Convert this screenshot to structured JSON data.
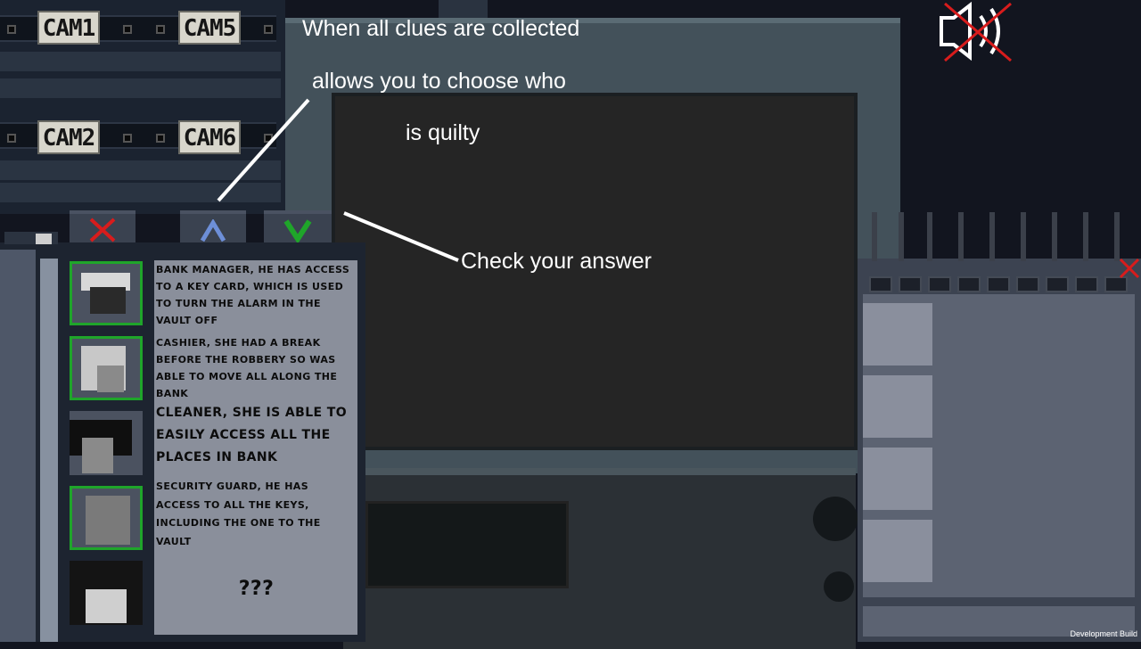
{
  "cameras": [
    {
      "label": "CAM1"
    },
    {
      "label": "CAM5"
    },
    {
      "label": "CAM2"
    },
    {
      "label": "CAM6"
    }
  ],
  "tutorial": {
    "line1": "When all clues are collected",
    "line2": "allows you to choose who",
    "line3": "is quilty",
    "check": "Check your answer"
  },
  "suspects": [
    {
      "description": "Bank manager, he has access to a key card, which is used to turn the alarm in the vault off",
      "selected": true
    },
    {
      "description": "Cashier, she had a break before the robbery so was able to move all along the bank",
      "selected": true
    },
    {
      "description": "Cleaner, she is able to easily access all the places in bank",
      "selected": false
    },
    {
      "description": "Security guard, he has access to all the keys, including the one to the vault",
      "selected": true
    },
    {
      "description": "???",
      "selected": false
    }
  ],
  "actions": {
    "cancel_icon": "red-x-icon",
    "choose_icon": "blue-up-arrow-icon",
    "confirm_icon": "green-check-icon"
  },
  "audio": {
    "icon": "speaker-muted-icon",
    "state": "muted"
  },
  "footer": {
    "build_label": "Development Build"
  },
  "colors": {
    "selected_border": "#1fa52a",
    "cancel": "#d81c1c",
    "choose": "#6d8fd8",
    "confirm": "#1fa52a"
  }
}
